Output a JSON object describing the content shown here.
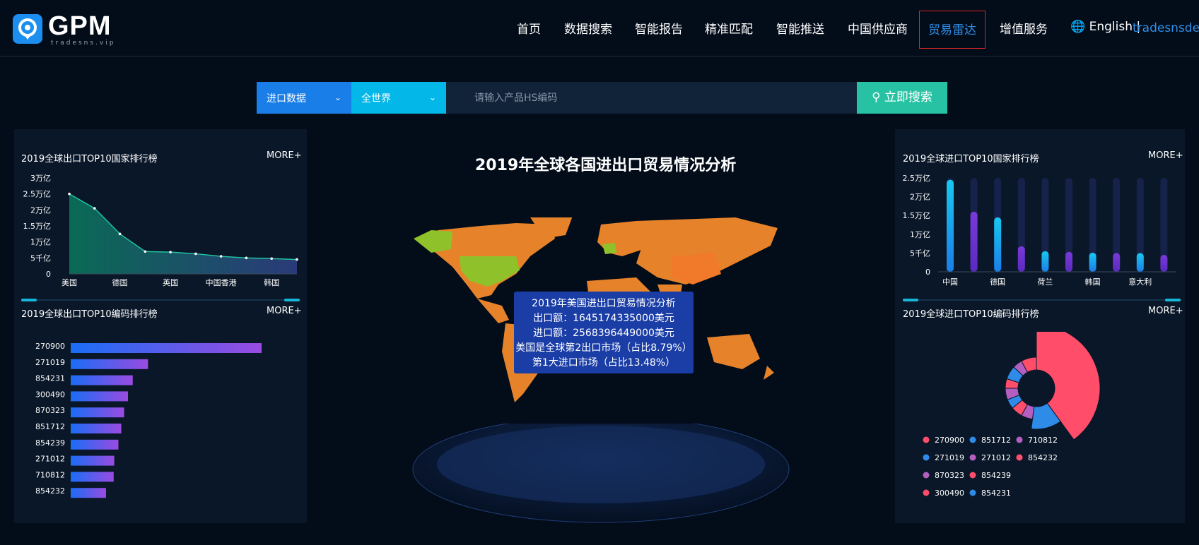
{
  "header": {
    "logo_text": "GPM",
    "logo_sub": "tradesns.vip",
    "nav": [
      "首页",
      "数据搜索",
      "智能报告",
      "精准匹配",
      "智能推送",
      "中国供应商",
      "贸易雷达",
      "增值服务"
    ],
    "active_nav": "贸易雷达",
    "language": "English",
    "separator": "|",
    "user": "tradesnsde"
  },
  "search": {
    "type": "进口数据",
    "region": "全世界",
    "placeholder": "请输入产品HS编码",
    "button": "立即搜索"
  },
  "center": {
    "title": "2019年全球各国进出口贸易情况分析",
    "tooltip": [
      "2019年美国进出口贸易情况分析",
      "出口额：1645174335000美元",
      "进口额：2568396449000美元",
      "美国是全球第2出口市场（占比8.79%）",
      "第1大进口市场（占比13.48%）"
    ]
  },
  "colors": {
    "bg": "#030c19",
    "panel": "#0a1728",
    "accent": "#1a7ee8",
    "cyan": "#04b7e9",
    "teal": "#27c2a3",
    "active_border": "#d8262a"
  },
  "chart_data": [
    {
      "type": "area",
      "title": "2019全球出口TOP10国家排行榜",
      "more": "MORE+",
      "y_ticks": [
        "3万亿",
        "2.5万亿",
        "2万亿",
        "1.5万亿",
        "1万亿",
        "5千亿",
        "0"
      ],
      "ylim": [
        0,
        30000
      ],
      "x_labels": [
        "美国",
        "德国",
        "英国",
        "中国香港",
        "韩国"
      ],
      "values": [
        25000,
        20500,
        12500,
        7000,
        6800,
        6300,
        5500,
        5000,
        4800,
        4500
      ],
      "unit_note": "values in 亿"
    },
    {
      "type": "bar",
      "orientation": "horizontal",
      "title": "2019全球出口TOP10编码排行榜",
      "more": "MORE+",
      "categories": [
        "270900",
        "271019",
        "854231",
        "300490",
        "870323",
        "851712",
        "854239",
        "271012",
        "710812",
        "854232"
      ],
      "values": [
        100,
        40.5,
        32.5,
        30,
        28,
        26.5,
        25,
        22.8,
        22.5,
        18.5
      ]
    },
    {
      "type": "bar",
      "title": "2019全球进口TOP10国家排行榜",
      "more": "MORE+",
      "y_ticks": [
        "2.5万亿",
        "2万亿",
        "1.5万亿",
        "1万亿",
        "5千亿",
        "0"
      ],
      "ylim": [
        0,
        25000
      ],
      "x_labels": [
        "中国",
        "德国",
        "荷兰",
        "韩国",
        "意大利"
      ],
      "values": [
        24500,
        16000,
        14500,
        6800,
        5500,
        5300,
        5100,
        5000,
        5000,
        4500
      ]
    },
    {
      "type": "pie",
      "title": "2019全球进口TOP10编码排行榜",
      "more": "MORE+",
      "labels": [
        "270900",
        "271019",
        "870323",
        "300490",
        "851712",
        "271012",
        "854239",
        "854231",
        "710812",
        "854232"
      ],
      "values": [
        40,
        12,
        6,
        6,
        5,
        6,
        5,
        7,
        5,
        8
      ],
      "slice_colors": [
        "#ff4d6a",
        "#2f8be8",
        "#b45fc0",
        "#ff4d6a",
        "#2f8be8",
        "#b45fc0",
        "#ff4d6a",
        "#2f8be8",
        "#b45fc0",
        "#ff4d6a"
      ]
    }
  ]
}
